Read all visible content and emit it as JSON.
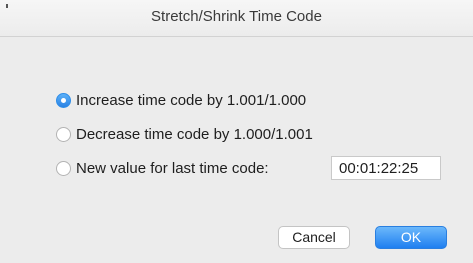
{
  "window": {
    "title": "Stretch/Shrink Time Code"
  },
  "options": [
    {
      "label": "Increase time code by 1.001/1.000",
      "selected": true
    },
    {
      "label": "Decrease time code by 1.000/1.001",
      "selected": false
    },
    {
      "label": "New value for last time code:",
      "selected": false
    }
  ],
  "last_time_code": {
    "value": "00:01:22:25"
  },
  "buttons": {
    "cancel_label": "Cancel",
    "ok_label": "OK"
  },
  "colors": {
    "accent": "#2a82e4",
    "background": "#ececec"
  }
}
